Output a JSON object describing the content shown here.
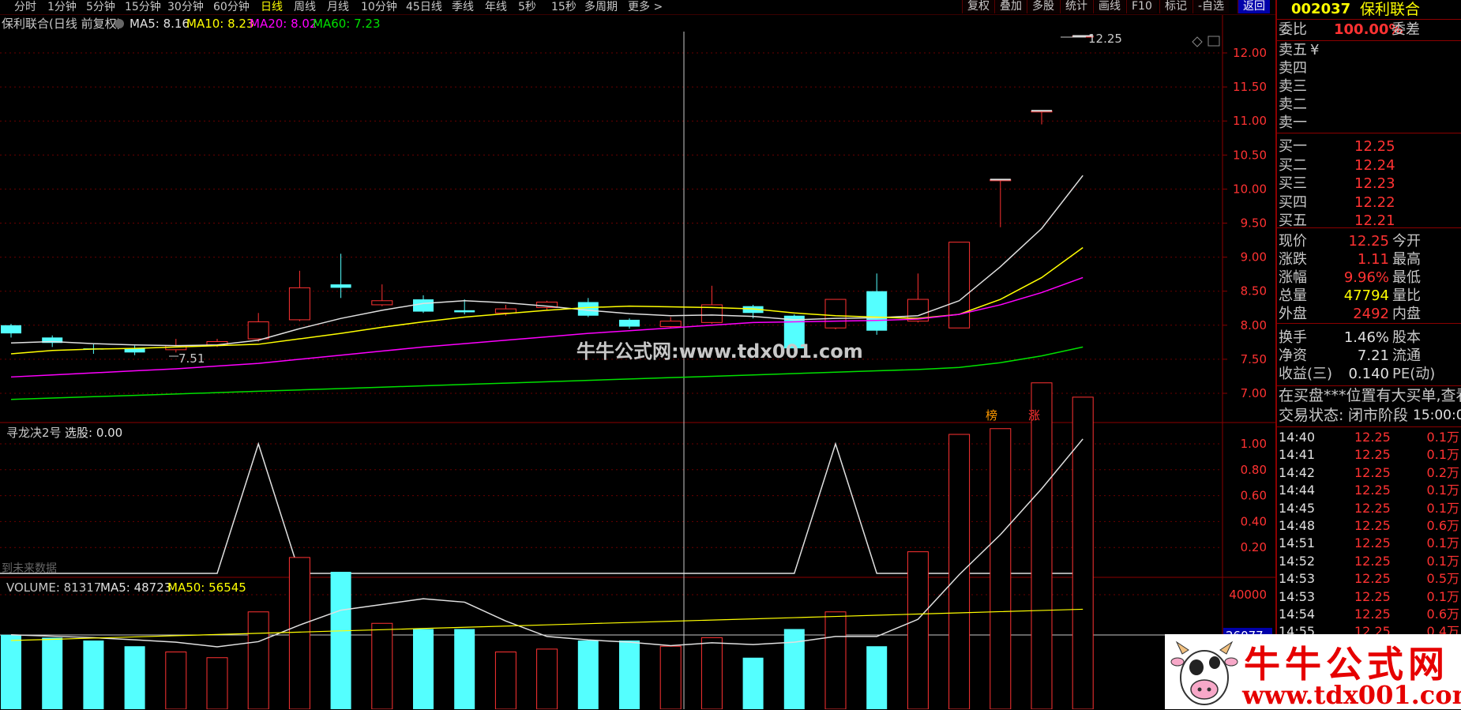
{
  "toolbar": {
    "periods": [
      "分时",
      "1分钟",
      "5分钟",
      "15分钟",
      "30分钟",
      "60分钟",
      "日线",
      "周线",
      "月线",
      "10分钟",
      "45日线",
      "季线",
      "年线",
      "5秒",
      "15秒",
      "多周期",
      "更多 >"
    ],
    "active_period": "日线",
    "buttons": [
      "复权",
      "叠加",
      "多股",
      "统计",
      "画线",
      "F10",
      "标记",
      "-自选",
      "返回"
    ]
  },
  "main_chart": {
    "title": "保利联合(日线 前复权)",
    "ma_labels": [
      {
        "label": "MA5: 8.16",
        "color": "#e0e0e0"
      },
      {
        "label": "MA10: 8.23",
        "color": "#ffff00"
      },
      {
        "label": "MA20: 8.02",
        "color": "#ff00ff"
      },
      {
        "label": "MA60: 7.23",
        "color": "#00e000"
      }
    ],
    "price_ticks": [
      "12.00",
      "11.50",
      "11.00",
      "10.50",
      "10.00",
      "9.50",
      "9.00",
      "8.50",
      "8.00",
      "7.50",
      "7.00"
    ],
    "high_marker": "12.25",
    "low_marker": "7.51",
    "tags": [
      "榜",
      "涨"
    ],
    "watermark_text": "牛牛公式网:www.tdx001.com"
  },
  "indicator_chart": {
    "title": "寻龙决2号",
    "value_label": "选股: 0.00",
    "ticks": [
      "1.00",
      "0.80",
      "0.60",
      "0.40",
      "0.20"
    ],
    "footnote": "到未来数据"
  },
  "volume_chart": {
    "title": "VOLUME: 81317",
    "ma5": "MA5: 48723",
    "ma50": "MA50: 56545",
    "ticks": [
      "40000"
    ],
    "current_label": "26077"
  },
  "quote": {
    "code": "002037",
    "name": "保利联合",
    "wb_label": "委比",
    "wb_value": "100.00%",
    "wc_label": "委差",
    "sells": [
      {
        "label": "卖五",
        "price": "¥"
      },
      {
        "label": "卖四",
        "price": ""
      },
      {
        "label": "卖三",
        "price": ""
      },
      {
        "label": "卖二",
        "price": ""
      },
      {
        "label": "卖一",
        "price": ""
      }
    ],
    "buys": [
      {
        "label": "买一",
        "price": "12.25"
      },
      {
        "label": "买二",
        "price": "12.24"
      },
      {
        "label": "买三",
        "price": "12.23"
      },
      {
        "label": "买四",
        "price": "12.22"
      },
      {
        "label": "买五",
        "price": "12.21"
      }
    ],
    "stats": [
      {
        "label": "现价",
        "value": "12.25",
        "value_color": "red",
        "label2": "今开"
      },
      {
        "label": "涨跌",
        "value": "1.11",
        "value_color": "red",
        "label2": "最高"
      },
      {
        "label": "涨幅",
        "value": "9.96%",
        "value_color": "red",
        "label2": "最低"
      },
      {
        "label": "总量",
        "value": "47794",
        "value_color": "yel",
        "label2": "量比"
      },
      {
        "label": "外盘",
        "value": "2492",
        "value_color": "red",
        "label2": "内盘"
      }
    ],
    "stats2": [
      {
        "label": "换手",
        "value": "1.46%",
        "label2": "股本"
      },
      {
        "label": "净资",
        "value": "7.21",
        "label2": "流通"
      },
      {
        "label": "收益(三)",
        "value": "0.140",
        "label2": "PE(动)"
      }
    ],
    "notice": "在买盘***位置有大买单,查看",
    "state_label": "交易状态:",
    "state_value": "闭市阶段",
    "state_time": "15:00:0",
    "ticks": [
      {
        "time": "14:40",
        "price": "12.25",
        "vol": "0.1万"
      },
      {
        "time": "14:41",
        "price": "12.25",
        "vol": "0.1万"
      },
      {
        "time": "14:42",
        "price": "12.25",
        "vol": "0.2万"
      },
      {
        "time": "14:44",
        "price": "12.25",
        "vol": "0.1万"
      },
      {
        "time": "14:45",
        "price": "12.25",
        "vol": "0.1万"
      },
      {
        "time": "14:48",
        "price": "12.25",
        "vol": "0.6万"
      },
      {
        "time": "14:51",
        "price": "12.25",
        "vol": "0.1万"
      },
      {
        "time": "14:52",
        "price": "12.25",
        "vol": "0.1万"
      },
      {
        "time": "14:53",
        "price": "12.25",
        "vol": "0.5万"
      },
      {
        "time": "14:53",
        "price": "12.25",
        "vol": "0.1万"
      },
      {
        "time": "14:54",
        "price": "12.25",
        "vol": "0.6万"
      },
      {
        "time": "14:55",
        "price": "12.25",
        "vol": "0.4万"
      }
    ]
  },
  "banner": {
    "title": "牛牛公式网",
    "url": "www.tdx001.com"
  },
  "chart_data": {
    "type": "candlestick",
    "price_axis": [
      7.0,
      12.0
    ],
    "candles": [
      {
        "o": 8.0,
        "c": 7.88,
        "h": 8.02,
        "l": 7.82
      },
      {
        "o": 7.82,
        "c": 7.74,
        "h": 7.85,
        "l": 7.68
      },
      {
        "o": 7.66,
        "c": 7.65,
        "h": 7.72,
        "l": 7.58
      },
      {
        "o": 7.66,
        "c": 7.6,
        "h": 7.7,
        "l": 7.56
      },
      {
        "o": 7.64,
        "c": 7.7,
        "h": 7.8,
        "l": 7.6
      },
      {
        "o": 7.71,
        "c": 7.76,
        "h": 7.8,
        "l": 7.68
      },
      {
        "o": 7.8,
        "c": 8.05,
        "h": 8.18,
        "l": 7.76
      },
      {
        "o": 8.08,
        "c": 8.55,
        "h": 8.8,
        "l": 8.06
      },
      {
        "o": 8.6,
        "c": 8.55,
        "h": 9.05,
        "l": 8.4
      },
      {
        "o": 8.3,
        "c": 8.36,
        "h": 8.6,
        "l": 8.28
      },
      {
        "o": 8.38,
        "c": 8.2,
        "h": 8.44,
        "l": 8.18
      },
      {
        "o": 8.22,
        "c": 8.19,
        "h": 8.38,
        "l": 8.16
      },
      {
        "o": 8.18,
        "c": 8.24,
        "h": 8.3,
        "l": 8.14
      },
      {
        "o": 8.26,
        "c": 8.34,
        "h": 8.36,
        "l": 8.22
      },
      {
        "o": 8.34,
        "c": 8.14,
        "h": 8.4,
        "l": 8.12
      },
      {
        "o": 8.08,
        "c": 7.98,
        "h": 8.1,
        "l": 7.95
      },
      {
        "o": 7.98,
        "c": 8.06,
        "h": 8.12,
        "l": 7.96
      },
      {
        "o": 8.04,
        "c": 8.3,
        "h": 8.58,
        "l": 8.02
      },
      {
        "o": 8.28,
        "c": 8.18,
        "h": 8.3,
        "l": 8.1
      },
      {
        "o": 8.14,
        "c": 7.66,
        "h": 8.16,
        "l": 7.62
      },
      {
        "o": 7.96,
        "c": 8.38,
        "h": 8.38,
        "l": 7.94
      },
      {
        "o": 8.5,
        "c": 7.92,
        "h": 8.76,
        "l": 7.86
      },
      {
        "o": 8.06,
        "c": 8.38,
        "h": 8.76,
        "l": 8.04
      },
      {
        "o": 7.96,
        "c": 9.22,
        "h": 9.22,
        "l": 7.96
      },
      {
        "o": 10.14,
        "c": 10.14,
        "h": 10.14,
        "l": 9.44
      },
      {
        "o": 11.15,
        "c": 11.15,
        "h": 11.15,
        "l": 10.95
      },
      {
        "o": 12.25,
        "c": 12.25,
        "h": 12.25,
        "l": 12.25
      }
    ],
    "ma_series": [
      {
        "name": "MA5",
        "color": "#e0e0e0",
        "start": 0,
        "values": [
          7.74,
          7.76,
          7.73,
          7.71,
          7.7,
          7.71,
          7.78,
          7.95,
          8.1,
          8.22,
          8.32,
          8.36,
          8.33,
          8.28,
          8.22,
          8.17,
          8.14,
          8.15,
          8.13,
          8.08,
          8.1,
          8.11,
          8.14,
          8.36,
          8.86,
          9.42,
          10.2
        ]
      },
      {
        "name": "MA10",
        "color": "#ffff00",
        "start": 0,
        "values": [
          7.58,
          7.63,
          7.65,
          7.66,
          7.68,
          7.7,
          7.72,
          7.8,
          7.88,
          7.97,
          8.05,
          8.12,
          8.17,
          8.22,
          8.26,
          8.28,
          8.27,
          8.26,
          8.24,
          8.18,
          8.14,
          8.12,
          8.1,
          8.16,
          8.38,
          8.7,
          9.14
        ]
      },
      {
        "name": "MA20",
        "color": "#ff00ff",
        "start": 0,
        "values": [
          7.24,
          7.27,
          7.3,
          7.33,
          7.36,
          7.4,
          7.44,
          7.5,
          7.56,
          7.62,
          7.68,
          7.73,
          7.78,
          7.83,
          7.88,
          7.92,
          7.96,
          8.0,
          8.04,
          8.05,
          8.06,
          8.07,
          8.09,
          8.16,
          8.3,
          8.48,
          8.7
        ]
      },
      {
        "name": "MA60",
        "color": "#00e000",
        "start": 0,
        "values": [
          6.91,
          6.93,
          6.95,
          6.97,
          6.99,
          7.01,
          7.03,
          7.05,
          7.07,
          7.09,
          7.11,
          7.13,
          7.15,
          7.17,
          7.19,
          7.21,
          7.23,
          7.25,
          7.27,
          7.29,
          7.31,
          7.33,
          7.35,
          7.38,
          7.45,
          7.55,
          7.68
        ]
      }
    ],
    "signal_values": [
      0,
      0,
      0,
      0,
      0,
      0,
      1,
      0,
      0,
      0,
      0,
      0,
      0,
      0,
      0,
      0,
      0,
      0,
      0,
      0,
      1,
      0,
      0,
      0,
      0,
      0,
      0
    ],
    "volumes": [
      26000,
      25000,
      24000,
      22000,
      20000,
      18000,
      34000,
      53000,
      48000,
      30000,
      28000,
      28000,
      20000,
      21000,
      24000,
      24000,
      22000,
      25000,
      18000,
      28000,
      34000,
      22000,
      55000,
      96000,
      98000,
      114000,
      109000
    ],
    "volume_axis_max": 40000
  }
}
